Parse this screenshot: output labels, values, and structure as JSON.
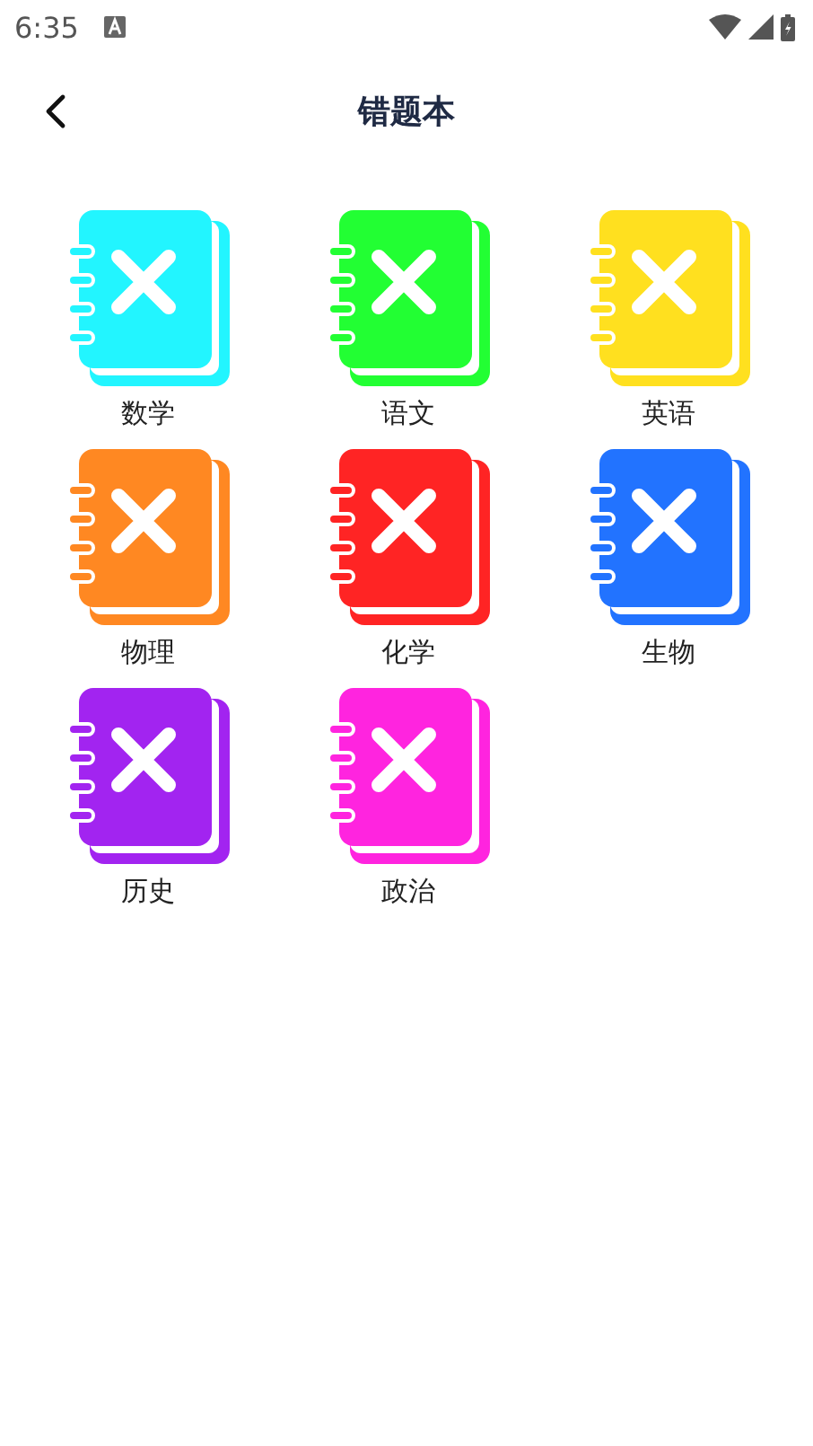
{
  "status_bar": {
    "time": "6:35"
  },
  "header": {
    "title": "错题本"
  },
  "subjects": [
    {
      "label": "数学",
      "color": "#22f5ff"
    },
    {
      "label": "语文",
      "color": "#22ff33"
    },
    {
      "label": "英语",
      "color": "#ffe01f"
    },
    {
      "label": "物理",
      "color": "#ff8822"
    },
    {
      "label": "化学",
      "color": "#ff2424"
    },
    {
      "label": "生物",
      "color": "#2273ff"
    },
    {
      "label": "历史",
      "color": "#a224f0"
    },
    {
      "label": "政治",
      "color": "#ff24df"
    }
  ]
}
